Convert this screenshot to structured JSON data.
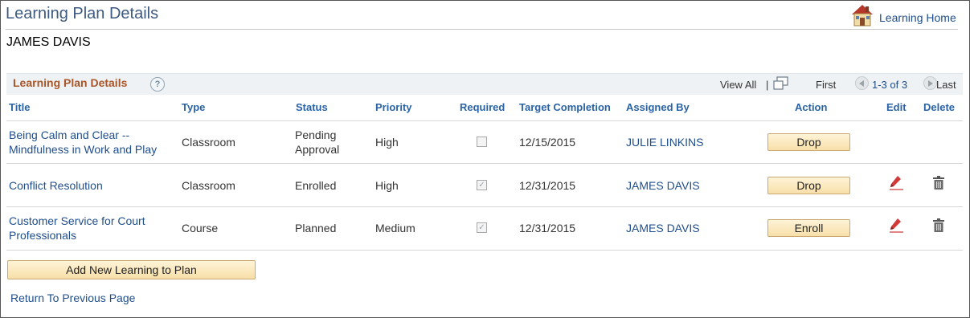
{
  "page": {
    "title": "Learning Plan Details",
    "home_link": "Learning Home"
  },
  "person": {
    "name": "JAMES DAVIS"
  },
  "grid": {
    "title": "Learning Plan Details",
    "help": "?",
    "view_all": "View All",
    "separator": "|",
    "first": "First",
    "range": "1-3 of 3",
    "last": "Last"
  },
  "columns": {
    "title": "Title",
    "type": "Type",
    "status": "Status",
    "priority": "Priority",
    "required": "Required",
    "target": "Target Completion",
    "assigned": "Assigned By",
    "action": "Action",
    "edit": "Edit",
    "delete": "Delete"
  },
  "rows": [
    {
      "title_line1": "Being Calm and Clear --",
      "title_line2": "Mindfulness in Work and Play",
      "type": "Classroom",
      "status_line1": "Pending",
      "status_line2": "Approval",
      "priority": "High",
      "required": false,
      "target": "12/15/2015",
      "assigned_by": "JULIE LINKINS",
      "action": "Drop",
      "edit": false,
      "delete": false
    },
    {
      "title_line1": "Conflict Resolution",
      "title_line2": "",
      "type": "Classroom",
      "status_line1": "Enrolled",
      "status_line2": "",
      "priority": "High",
      "required": true,
      "target": "12/31/2015",
      "assigned_by": "JAMES DAVIS",
      "action": "Drop",
      "edit": true,
      "delete": true
    },
    {
      "title_line1": "Customer Service for Court",
      "title_line2": "Professionals",
      "type": "Course",
      "status_line1": "Planned",
      "status_line2": "",
      "priority": "Medium",
      "required": true,
      "target": "12/31/2015",
      "assigned_by": "JAMES DAVIS",
      "action": "Enroll",
      "edit": true,
      "delete": true
    }
  ],
  "buttons": {
    "add_new": "Add New Learning to Plan"
  },
  "links": {
    "return": "Return To Previous Page"
  },
  "colors": {
    "title": "#3d5a80",
    "link": "#1f4e8c",
    "grid_title": "#a9562a",
    "button": "#f7dfa8"
  }
}
